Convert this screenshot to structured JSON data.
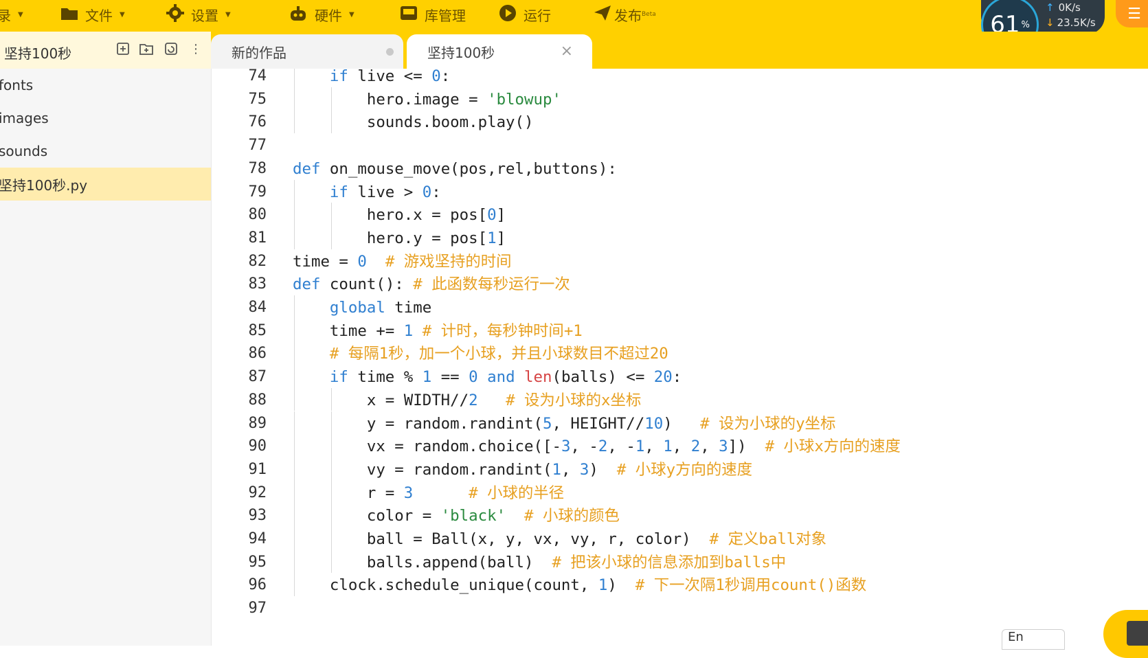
{
  "menu": {
    "items": [
      {
        "label": "录",
        "icon": "book-icon"
      },
      {
        "label": "文件",
        "icon": "folder-icon"
      },
      {
        "label": "设置",
        "icon": "gear-icon"
      },
      {
        "label": "硬件",
        "icon": "robot-icon"
      },
      {
        "label": "库管理",
        "icon": "library-icon"
      },
      {
        "label": "运行",
        "icon": "play-icon"
      },
      {
        "label": "发布",
        "icon": "send-icon",
        "badge": "Beta"
      }
    ]
  },
  "net_widget": {
    "cpu_percent": "61",
    "cpu_unit": "%",
    "upload": "0K/s",
    "download": "23.5K/s"
  },
  "sidebar": {
    "project_title": "坚持100秒",
    "files": [
      {
        "label": "fonts"
      },
      {
        "label": "images"
      },
      {
        "label": "sounds"
      },
      {
        "label": "坚持100秒.py",
        "selected": true
      }
    ]
  },
  "tabs": [
    {
      "label": "新的作品",
      "state": "unsaved"
    },
    {
      "label": "坚持100秒",
      "state": "active"
    }
  ],
  "editor": {
    "line_numbers": [
      "74",
      "75",
      "76",
      "77",
      "78",
      "79",
      "80",
      "81",
      "82",
      "83",
      "84",
      "85",
      "86",
      "87",
      "88",
      "89",
      "90",
      "91",
      "92",
      "93",
      "94",
      "95",
      "96",
      "97"
    ],
    "lines": [
      "    if live <= 0:",
      "        hero.image = 'blowup'",
      "        sounds.boom.play()",
      "",
      "def on_mouse_move(pos,rel,buttons):",
      "    if live > 0:",
      "        hero.x = pos[0]",
      "        hero.y = pos[1]",
      "time = 0  # 游戏坚持的时间",
      "def count(): # 此函数每秒运行一次",
      "    global time",
      "    time += 1 # 计时，每秒钟时间+1",
      "    # 每隔1秒，加一个小球，并且小球数目不超过20",
      "    if time % 1 == 0 and len(balls) <= 20:",
      "        x = WIDTH//2   # 设为小球的x坐标",
      "        y = random.randint(5, HEIGHT//10)   # 设为小球的y坐标",
      "        vx = random.choice([-3, -2, -1, 1, 2, 3])  # 小球x方向的速度",
      "        vy = random.randint(1, 3)  # 小球y方向的速度",
      "        r = 3      # 小球的半径",
      "        color = 'black'  # 小球的颜色",
      "        ball = Ball(x, y, vx, vy, r, color)  # 定义ball对象",
      "        balls.append(ball)  # 把该小球的信息添加到balls中",
      "    clock.schedule_unique(count, 1)  # 下一次隔1秒调用count()函数",
      ""
    ]
  },
  "ime": {
    "label": "En"
  },
  "colors": {
    "toolbar": "#ffd000",
    "keyword": "#2f7fd0",
    "string": "#2a8a3f",
    "comment": "#e7a021",
    "builtin": "#d64545",
    "selected_file": "#ffecae"
  }
}
